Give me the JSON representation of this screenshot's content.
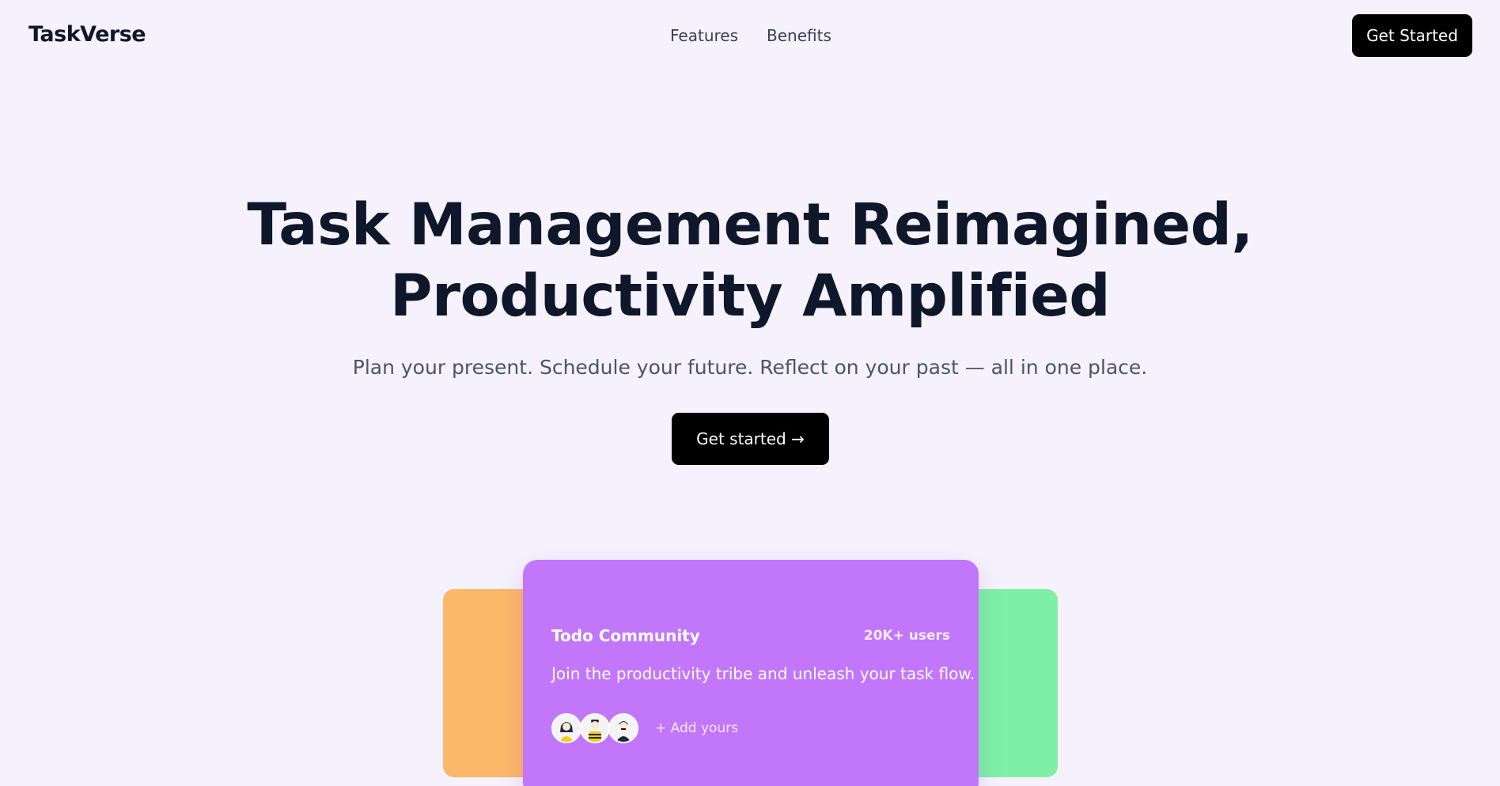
{
  "nav": {
    "logo": "TaskVerse",
    "links": [
      {
        "label": "Features"
      },
      {
        "label": "Benefits"
      }
    ],
    "cta_label": "Get Started"
  },
  "hero": {
    "headline_line1": "Task Management Reimagined,",
    "headline_line2": "Productivity Amplified",
    "subheadline": "Plan your present. Schedule your future. Reflect on your past — all in one place.",
    "cta_label": "Get started →"
  },
  "community_card": {
    "title": "Todo Community",
    "badge": "20K+ users",
    "description": "Join the productivity tribe and unleash your task flow.",
    "add_label": "+ Add yours",
    "avatars": [
      {
        "icon": "avatar-woman-yellow-icon"
      },
      {
        "icon": "avatar-man-striped-icon"
      },
      {
        "icon": "avatar-man-dark-icon"
      }
    ]
  },
  "colors": {
    "background": "#f5f2fd",
    "card_main": "#c277fb",
    "card_left": "#fdb769",
    "card_right": "#7ef0a5",
    "button": "#000000"
  }
}
